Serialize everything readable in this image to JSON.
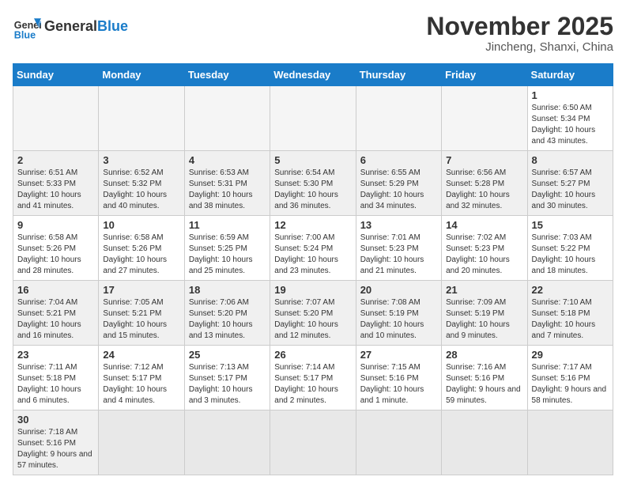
{
  "header": {
    "logo_general": "General",
    "logo_blue": "Blue",
    "month_title": "November 2025",
    "subtitle": "Jincheng, Shanxi, China"
  },
  "weekdays": [
    "Sunday",
    "Monday",
    "Tuesday",
    "Wednesday",
    "Thursday",
    "Friday",
    "Saturday"
  ],
  "days": {
    "1": {
      "sunrise": "6:50 AM",
      "sunset": "5:34 PM",
      "daylight": "10 hours and 43 minutes."
    },
    "2": {
      "sunrise": "6:51 AM",
      "sunset": "5:33 PM",
      "daylight": "10 hours and 41 minutes."
    },
    "3": {
      "sunrise": "6:52 AM",
      "sunset": "5:32 PM",
      "daylight": "10 hours and 40 minutes."
    },
    "4": {
      "sunrise": "6:53 AM",
      "sunset": "5:31 PM",
      "daylight": "10 hours and 38 minutes."
    },
    "5": {
      "sunrise": "6:54 AM",
      "sunset": "5:30 PM",
      "daylight": "10 hours and 36 minutes."
    },
    "6": {
      "sunrise": "6:55 AM",
      "sunset": "5:29 PM",
      "daylight": "10 hours and 34 minutes."
    },
    "7": {
      "sunrise": "6:56 AM",
      "sunset": "5:28 PM",
      "daylight": "10 hours and 32 minutes."
    },
    "8": {
      "sunrise": "6:57 AM",
      "sunset": "5:27 PM",
      "daylight": "10 hours and 30 minutes."
    },
    "9": {
      "sunrise": "6:58 AM",
      "sunset": "5:26 PM",
      "daylight": "10 hours and 28 minutes."
    },
    "10": {
      "sunrise": "6:58 AM",
      "sunset": "5:26 PM",
      "daylight": "10 hours and 27 minutes."
    },
    "11": {
      "sunrise": "6:59 AM",
      "sunset": "5:25 PM",
      "daylight": "10 hours and 25 minutes."
    },
    "12": {
      "sunrise": "7:00 AM",
      "sunset": "5:24 PM",
      "daylight": "10 hours and 23 minutes."
    },
    "13": {
      "sunrise": "7:01 AM",
      "sunset": "5:23 PM",
      "daylight": "10 hours and 21 minutes."
    },
    "14": {
      "sunrise": "7:02 AM",
      "sunset": "5:23 PM",
      "daylight": "10 hours and 20 minutes."
    },
    "15": {
      "sunrise": "7:03 AM",
      "sunset": "5:22 PM",
      "daylight": "10 hours and 18 minutes."
    },
    "16": {
      "sunrise": "7:04 AM",
      "sunset": "5:21 PM",
      "daylight": "10 hours and 16 minutes."
    },
    "17": {
      "sunrise": "7:05 AM",
      "sunset": "5:21 PM",
      "daylight": "10 hours and 15 minutes."
    },
    "18": {
      "sunrise": "7:06 AM",
      "sunset": "5:20 PM",
      "daylight": "10 hours and 13 minutes."
    },
    "19": {
      "sunrise": "7:07 AM",
      "sunset": "5:20 PM",
      "daylight": "10 hours and 12 minutes."
    },
    "20": {
      "sunrise": "7:08 AM",
      "sunset": "5:19 PM",
      "daylight": "10 hours and 10 minutes."
    },
    "21": {
      "sunrise": "7:09 AM",
      "sunset": "5:19 PM",
      "daylight": "10 hours and 9 minutes."
    },
    "22": {
      "sunrise": "7:10 AM",
      "sunset": "5:18 PM",
      "daylight": "10 hours and 7 minutes."
    },
    "23": {
      "sunrise": "7:11 AM",
      "sunset": "5:18 PM",
      "daylight": "10 hours and 6 minutes."
    },
    "24": {
      "sunrise": "7:12 AM",
      "sunset": "5:17 PM",
      "daylight": "10 hours and 4 minutes."
    },
    "25": {
      "sunrise": "7:13 AM",
      "sunset": "5:17 PM",
      "daylight": "10 hours and 3 minutes."
    },
    "26": {
      "sunrise": "7:14 AM",
      "sunset": "5:17 PM",
      "daylight": "10 hours and 2 minutes."
    },
    "27": {
      "sunrise": "7:15 AM",
      "sunset": "5:16 PM",
      "daylight": "10 hours and 1 minute."
    },
    "28": {
      "sunrise": "7:16 AM",
      "sunset": "5:16 PM",
      "daylight": "9 hours and 59 minutes."
    },
    "29": {
      "sunrise": "7:17 AM",
      "sunset": "5:16 PM",
      "daylight": "9 hours and 58 minutes."
    },
    "30": {
      "sunrise": "7:18 AM",
      "sunset": "5:16 PM",
      "daylight": "9 hours and 57 minutes."
    }
  }
}
